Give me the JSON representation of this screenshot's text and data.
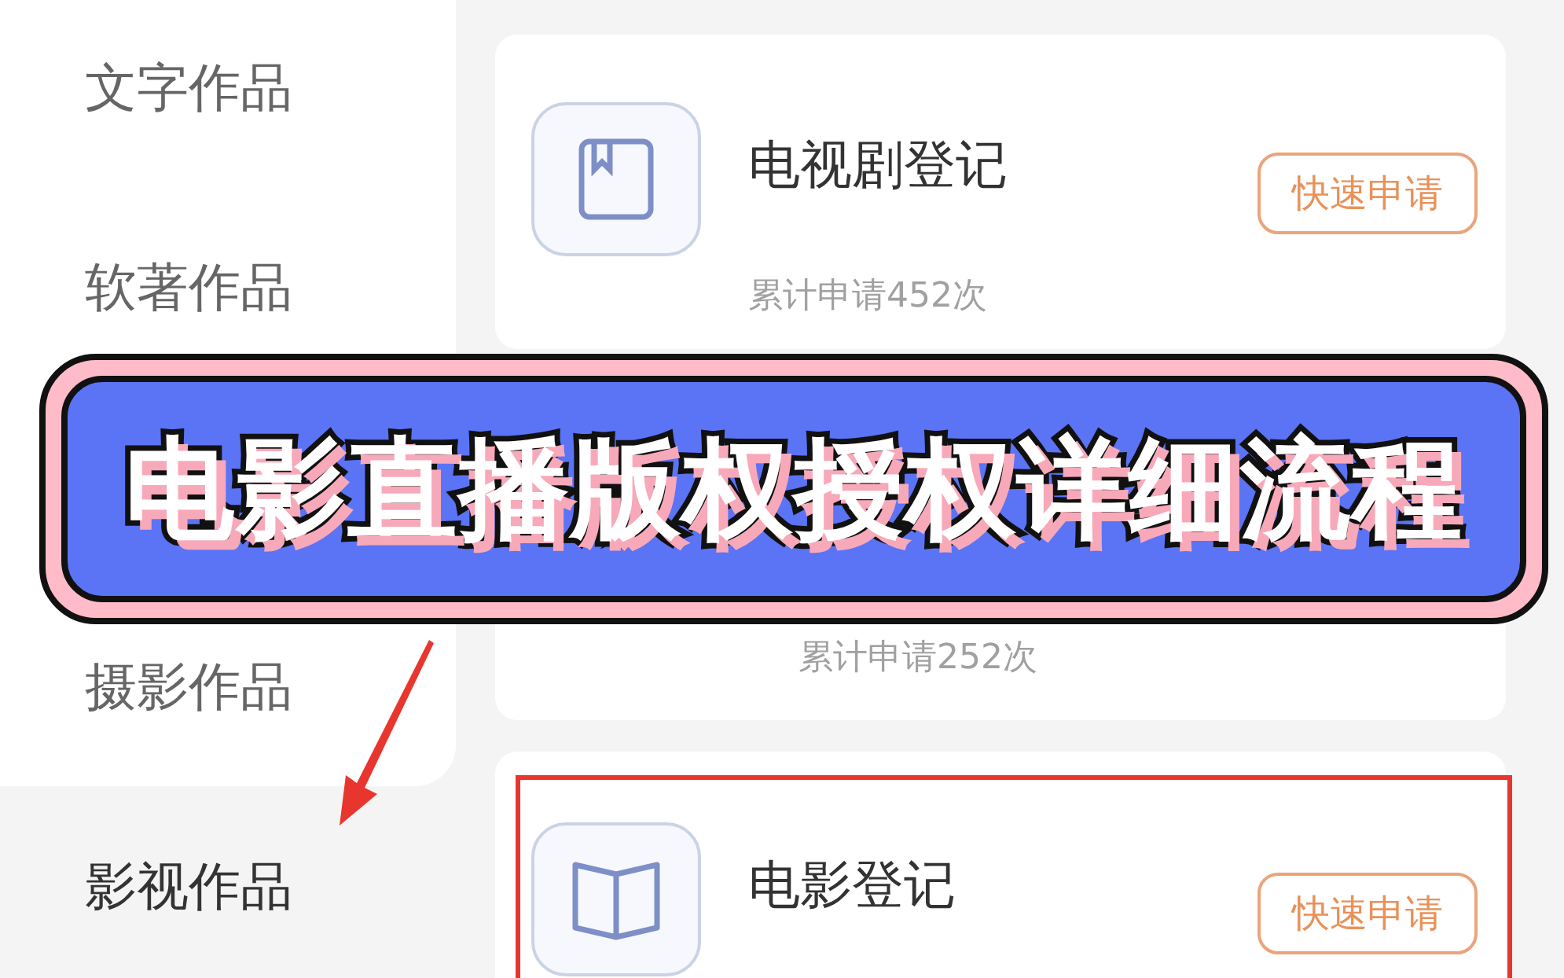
{
  "sidebar": {
    "items": [
      {
        "label": "文字作品",
        "selected": false
      },
      {
        "label": "软著作品",
        "selected": false
      },
      {
        "label": "摄影作品",
        "selected": false
      },
      {
        "label": "影视作品",
        "selected": true
      }
    ]
  },
  "cards": [
    {
      "kind": "full",
      "title": "电视剧登记",
      "subtitle": "累计申请452次",
      "button": "快速申请",
      "highlighted": false
    },
    {
      "kind": "partial",
      "subtitle": "累计申请252次",
      "highlighted": false
    },
    {
      "kind": "full",
      "title": "电影登记",
      "button": "快速申请",
      "highlighted": true
    }
  ],
  "banner": {
    "title": "电影直播版权授权详细流程"
  }
}
